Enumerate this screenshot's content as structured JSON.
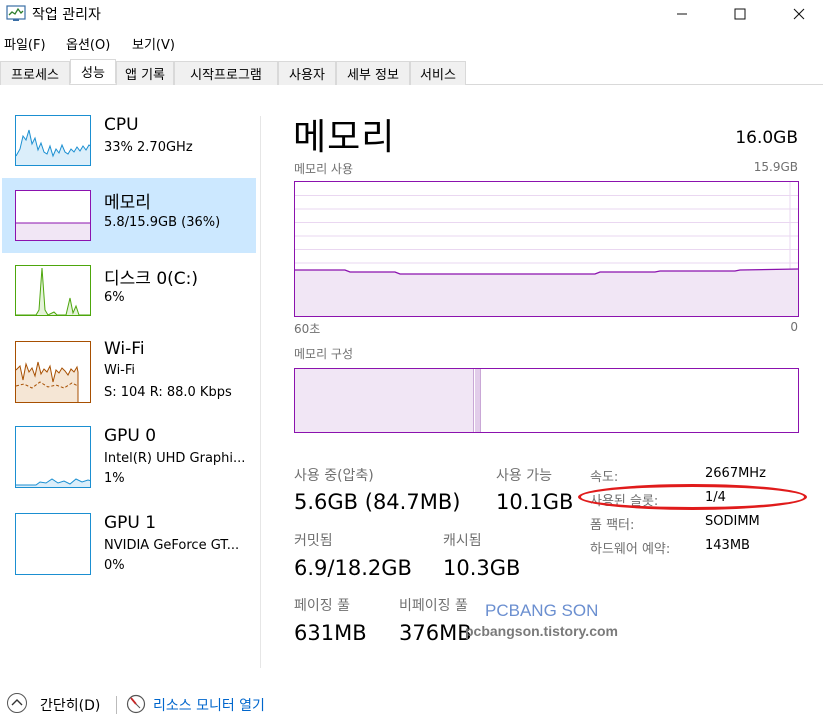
{
  "window": {
    "title": "작업 관리자"
  },
  "menu": [
    "파일(F)",
    "옵션(O)",
    "보기(V)"
  ],
  "tabs": [
    "프로세스",
    "성능",
    "앱 기록",
    "시작프로그램",
    "사용자",
    "세부 정보",
    "서비스"
  ],
  "active_tab": "성능",
  "sidebar": [
    {
      "title": "CPU",
      "sub1": "33% 2.70GHz",
      "sub2": "",
      "color": "#1b8fd1"
    },
    {
      "title": "메모리",
      "sub1": "5.8/15.9GB (36%)",
      "sub2": "",
      "color": "#8b12ae"
    },
    {
      "title": "디스크 0(C:)",
      "sub1": "6%",
      "sub2": "",
      "color": "#4da60c"
    },
    {
      "title": "Wi-Fi",
      "sub1": "Wi-Fi",
      "sub2": "S: 104 R: 88.0 Kbps",
      "color": "#a74f01"
    },
    {
      "title": "GPU 0",
      "sub1": "Intel(R) UHD Graphi...",
      "sub2": "1%",
      "color": "#1b8fd1"
    },
    {
      "title": "GPU 1",
      "sub1": "NVIDIA GeForce GT...",
      "sub2": "0%",
      "color": "#1b8fd1"
    }
  ],
  "main": {
    "title": "메모리",
    "total": "16.0GB",
    "usage_label": "메모리 사용",
    "usage_max": "15.9GB",
    "time_label": "60초",
    "time_end": "0",
    "composition_label": "메모리 구성",
    "memory_usage_fraction": 0.36
  },
  "stats": {
    "in_use_label": "사용 중(압축)",
    "in_use_value": "5.6GB (84.7MB)",
    "available_label": "사용 가능",
    "available_value": "10.1GB",
    "committed_label": "커밋됨",
    "committed_value": "6.9/18.2GB",
    "cached_label": "캐시됨",
    "cached_value": "10.3GB",
    "paged_label": "페이징 풀",
    "paged_value": "631MB",
    "nonpaged_label": "비페이징 풀",
    "nonpaged_value": "376MB"
  },
  "properties": [
    {
      "key": "속도:",
      "value": "2667MHz"
    },
    {
      "key": "사용된 슬롯:",
      "value": "1/4"
    },
    {
      "key": "폼 팩터:",
      "value": "SODIMM"
    },
    {
      "key": "하드웨어 예약:",
      "value": "143MB"
    }
  ],
  "watermark": {
    "line1": "PCBANG SON",
    "line2": "pcbangson.tistory.com"
  },
  "footer": {
    "less": "간단히(D)",
    "resource_monitor": "리소스 모니터 열기"
  },
  "colors": {
    "memory": "#8b12ae",
    "selection": "#cce8ff",
    "annotation": "#e01b1b"
  }
}
